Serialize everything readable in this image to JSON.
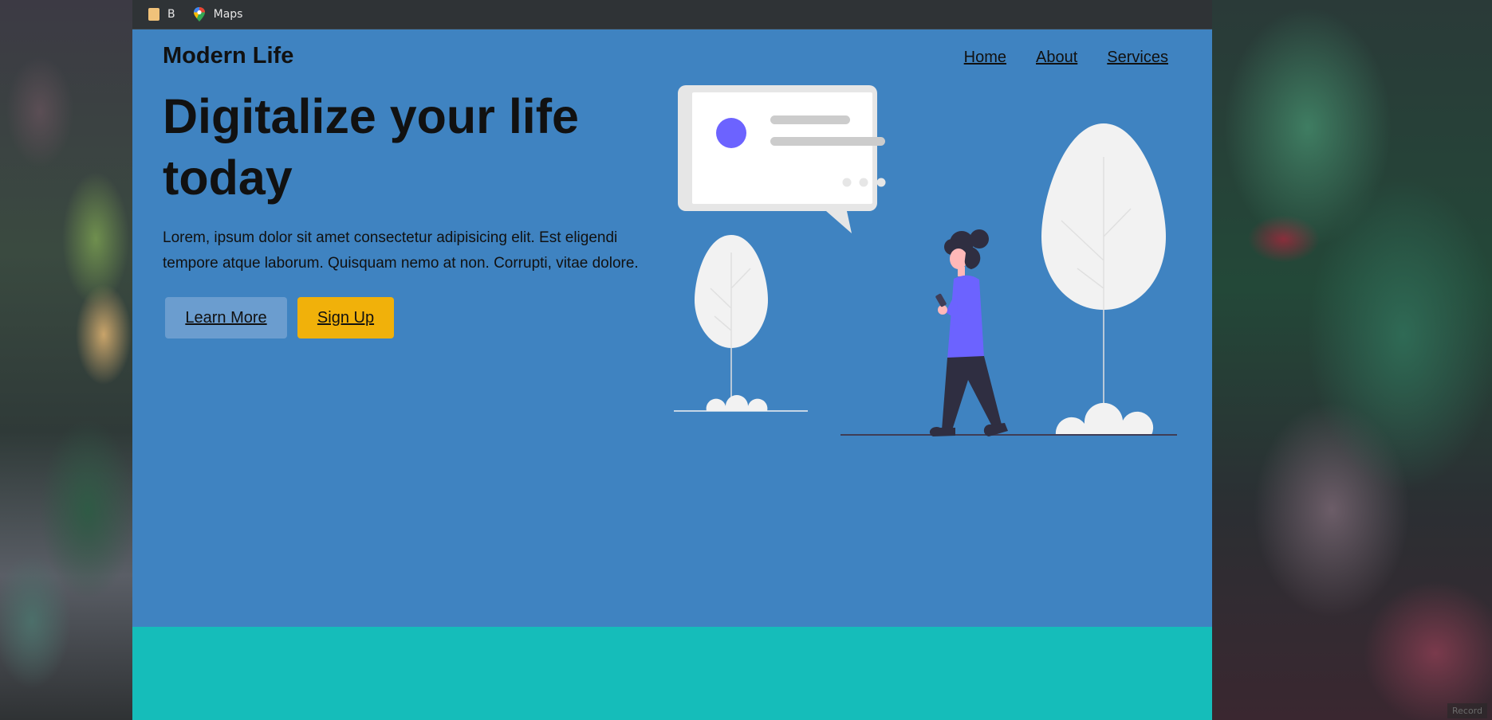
{
  "bookmarks": [
    {
      "label": "B",
      "icon": "folder-icon"
    },
    {
      "label": "Maps",
      "icon": "maps-icon"
    }
  ],
  "site": {
    "logo": "Modern Life",
    "nav": [
      "Home",
      "About",
      "Services"
    ]
  },
  "hero": {
    "headline": "Digitalize your life today",
    "lede": "Lorem, ipsum dolor sit amet consectetur adipisicing elit. Est eligendi tempore atque laborum. Quisquam nemo at non. Corrupti, vitae dolore.",
    "learn_more": "Learn More",
    "sign_up": "Sign Up"
  },
  "screen_recorder": {
    "label": "Record"
  },
  "colors": {
    "page_bg": "#3f83c1",
    "footer_band": "#15bdba",
    "signup_btn": "#f1b10a",
    "learn_btn": "#6b9dcf",
    "accent_purple": "#6c63ff",
    "bookmarks_bar": "#2f3336"
  }
}
